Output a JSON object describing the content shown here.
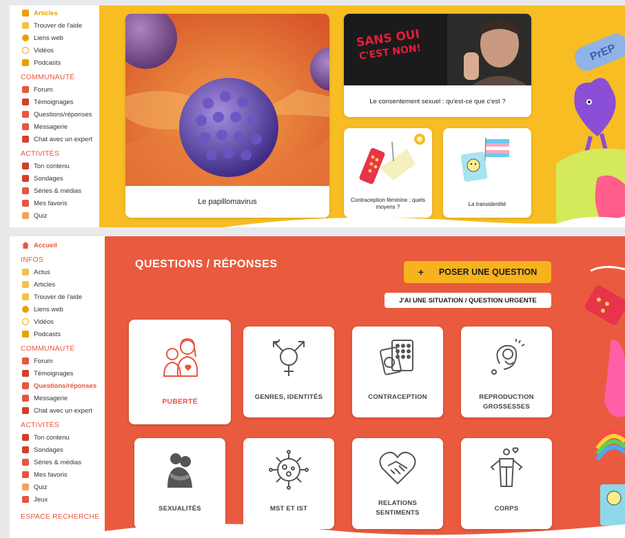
{
  "top_panel": {
    "sidebar": {
      "infos_items": [
        {
          "label": "Articles",
          "icon": "articles-icon",
          "color": "#e8a000"
        },
        {
          "label": "Trouver de l'aide",
          "icon": "map-icon",
          "color": "#f2c14e"
        },
        {
          "label": "Liens web",
          "icon": "info-icon",
          "color": "#e8a000"
        },
        {
          "label": "Vidéos",
          "icon": "play-icon",
          "color": "#e8a000"
        },
        {
          "label": "Podcasts",
          "icon": "microphone-icon",
          "color": "#e8a000"
        }
      ],
      "community_heading": "COMMUNAUTÉ",
      "community_items": [
        {
          "label": "Forum",
          "icon": "forum-icon",
          "color": "#e8553f"
        },
        {
          "label": "Témoignages",
          "icon": "testimony-icon",
          "color": "#d63e2a"
        },
        {
          "label": "Questions/réponses",
          "icon": "chat-bubble-icon",
          "color": "#e8553f"
        },
        {
          "label": "Messagerie",
          "icon": "message-icon",
          "color": "#e8553f"
        },
        {
          "label": "Chat avec un expert",
          "icon": "headset-icon",
          "color": "#d63e2a"
        }
      ],
      "activities_heading": "ACTIVITÉS",
      "activities_items": [
        {
          "label": "Ton contenu",
          "icon": "content-icon",
          "color": "#d63e2a"
        },
        {
          "label": "Sondages",
          "icon": "poll-icon",
          "color": "#d63e2a"
        },
        {
          "label": "Séries & médias",
          "icon": "media-icon",
          "color": "#e8553f"
        },
        {
          "label": "Mes favoris",
          "icon": "favorites-icon",
          "color": "#e8553f"
        },
        {
          "label": "Quiz",
          "icon": "quiz-icon",
          "color": "#f2a35e"
        }
      ]
    },
    "cards": {
      "main": "Le papillomavirus",
      "consent": "Le consentement sexuel : qu'est-ce que c'est ?",
      "consent_image_text_1": "SANS OUI",
      "consent_image_text_2": "C'EST NON!",
      "contraception": "Contraception féminine : quels moyens ?",
      "transidentity": "La transidentité"
    },
    "decor_text": "PrEP"
  },
  "bottom_panel": {
    "sidebar": {
      "home": "Accueil",
      "infos_heading": "INFOS",
      "infos_items": [
        {
          "label": "Actus",
          "icon": "news-icon",
          "color": "#f2c14e"
        },
        {
          "label": "Articles",
          "icon": "articles-icon",
          "color": "#f2c14e"
        },
        {
          "label": "Trouver de l'aide",
          "icon": "map-icon",
          "color": "#f2c14e"
        },
        {
          "label": "Liens web",
          "icon": "info-icon",
          "color": "#e8a000"
        },
        {
          "label": "Vidéos",
          "icon": "play-icon",
          "color": "#e8a000"
        },
        {
          "label": "Podcasts",
          "icon": "microphone-icon",
          "color": "#e8a000"
        }
      ],
      "community_heading": "COMMUNAUTÉ",
      "community_items": [
        {
          "label": "Forum",
          "icon": "forum-icon",
          "color": "#e8553f"
        },
        {
          "label": "Témoignages",
          "icon": "testimony-icon",
          "color": "#d63e2a"
        },
        {
          "label": "Questions/réponses",
          "icon": "chat-bubble-icon",
          "color": "#e8553f",
          "active": true
        },
        {
          "label": "Messagerie",
          "icon": "message-icon",
          "color": "#e8553f"
        },
        {
          "label": "Chat avec un expert",
          "icon": "headset-icon",
          "color": "#d63e2a"
        }
      ],
      "activities_heading": "ACTIVITÉS",
      "activities_items": [
        {
          "label": "Ton contenu",
          "icon": "content-icon",
          "color": "#d63e2a"
        },
        {
          "label": "Sondages",
          "icon": "poll-icon",
          "color": "#d63e2a"
        },
        {
          "label": "Séries & médias",
          "icon": "media-icon",
          "color": "#e8553f"
        },
        {
          "label": "Mes favoris",
          "icon": "favorites-icon",
          "color": "#e8553f"
        },
        {
          "label": "Quiz",
          "icon": "quiz-icon",
          "color": "#f2a35e"
        },
        {
          "label": "Jeux",
          "icon": "games-icon",
          "color": "#e8553f"
        }
      ],
      "search_heading": "ESPACE RECHERCHE"
    },
    "page_title": "QUESTIONS / RÉPONSES",
    "ask_plus": "+",
    "ask_button": "POSER UNE QUESTION",
    "urgent_button": "J'AI UNE SITUATION / QUESTION URGENTE",
    "categories": [
      {
        "label": "PUBERTÉ",
        "icon": "puberty-icon"
      },
      {
        "label": "GENRES, IDENTITÉS",
        "icon": "gender-symbol-icon"
      },
      {
        "label": "CONTRACEPTION",
        "icon": "contraception-icon"
      },
      {
        "label": "REPRODUCTION GROSSESSES",
        "icon": "fetus-icon"
      },
      {
        "label": "SEXUALITÉS",
        "icon": "hug-icon"
      },
      {
        "label": "MST ET IST",
        "icon": "virus-icon"
      },
      {
        "label": "RELATIONS SENTIMENTS",
        "icon": "heart-handshake-icon"
      },
      {
        "label": "CORPS",
        "icon": "body-icon"
      }
    ]
  },
  "colors": {
    "yellow_bg": "#f7bd23",
    "red_bg": "#ea5a3e",
    "accent_red": "#e8553f",
    "ask_button_bg": "#f6b31e"
  }
}
